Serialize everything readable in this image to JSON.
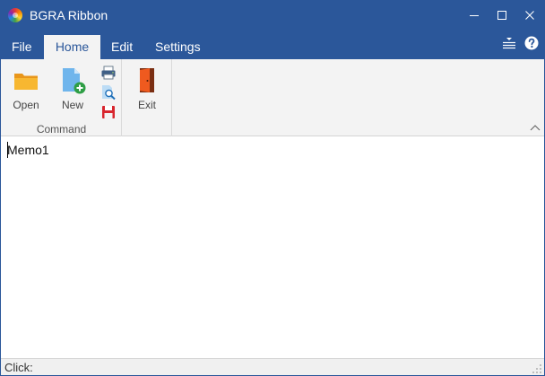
{
  "window": {
    "title": "BGRA Ribbon"
  },
  "tabs": [
    {
      "label": "File"
    },
    {
      "label": "Home"
    },
    {
      "label": "Edit"
    },
    {
      "label": "Settings"
    }
  ],
  "ribbon": {
    "command_group": {
      "caption": "Command",
      "open_label": "Open",
      "new_label": "New"
    },
    "exit_group": {
      "exit_label": "Exit"
    }
  },
  "memo": {
    "text": "Memo1"
  },
  "statusbar": {
    "text": "Click:"
  },
  "colors": {
    "accent": "#2b579a",
    "ribbon_bg": "#f3f3f3",
    "folder": "#f5a623",
    "exit_door": "#e8531e"
  },
  "icons": {
    "app": "app-color-wheel-icon",
    "minimize": "minimize-icon",
    "maximize": "maximize-icon",
    "close": "close-icon",
    "menu": "menu-lines-icon",
    "help": "help-icon",
    "open": "folder-icon",
    "new": "new-document-icon",
    "print": "printer-icon",
    "preview": "print-preview-icon",
    "save": "floppy-disk-icon",
    "exit": "exit-door-icon",
    "collapse": "chevron-up-icon"
  }
}
